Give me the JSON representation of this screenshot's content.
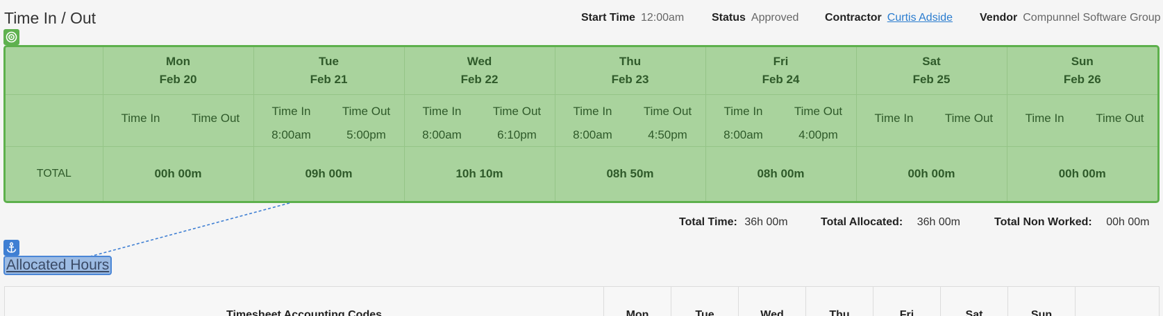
{
  "page": {
    "title": "Time In / Out"
  },
  "meta": {
    "start_time_label": "Start Time",
    "start_time_value": "12:00am",
    "status_label": "Status",
    "status_value": "Approved",
    "contractor_label": "Contractor",
    "contractor_value": "Curtis Adside",
    "vendor_label": "Vendor",
    "vendor_value": "Compunnel Software Group"
  },
  "time_table": {
    "time_in_label": "Time In",
    "time_out_label": "Time Out",
    "total_label": "TOTAL",
    "days": [
      {
        "day": "Mon",
        "date": "Feb 20",
        "time_in": "",
        "time_out": "",
        "total": "00h 00m"
      },
      {
        "day": "Tue",
        "date": "Feb 21",
        "time_in": "8:00am",
        "time_out": "5:00pm",
        "total": "09h 00m"
      },
      {
        "day": "Wed",
        "date": "Feb 22",
        "time_in": "8:00am",
        "time_out": "6:10pm",
        "total": "10h 10m"
      },
      {
        "day": "Thu",
        "date": "Feb 23",
        "time_in": "8:00am",
        "time_out": "4:50pm",
        "total": "08h 50m"
      },
      {
        "day": "Fri",
        "date": "Feb 24",
        "time_in": "8:00am",
        "time_out": "4:00pm",
        "total": "08h 00m"
      },
      {
        "day": "Sat",
        "date": "Feb 25",
        "time_in": "",
        "time_out": "",
        "total": "00h 00m"
      },
      {
        "day": "Sun",
        "date": "Feb 26",
        "time_in": "",
        "time_out": "",
        "total": "00h 00m"
      }
    ]
  },
  "totals": {
    "total_time_label": "Total Time:",
    "total_time_value": "36h 00m",
    "total_allocated_label": "Total Allocated:",
    "total_allocated_value": "36h 00m",
    "total_non_worked_label": "Total Non Worked:",
    "total_non_worked_value": "00h 00m"
  },
  "allocated": {
    "title": "Allocated Hours",
    "codes_header": "Timesheet Accounting Codes",
    "days": [
      "Mon",
      "Tue",
      "Wed",
      "Thu",
      "Fri",
      "Sat",
      "Sun"
    ]
  },
  "colors": {
    "green_fill": "#a9d39d",
    "green_border": "#5db04c",
    "blue_highlight": "#9cbbe3",
    "blue_border": "#4a86d6",
    "link": "#2a7ccf"
  },
  "icons": {
    "target": "target-icon",
    "anchor": "anchor-icon"
  }
}
